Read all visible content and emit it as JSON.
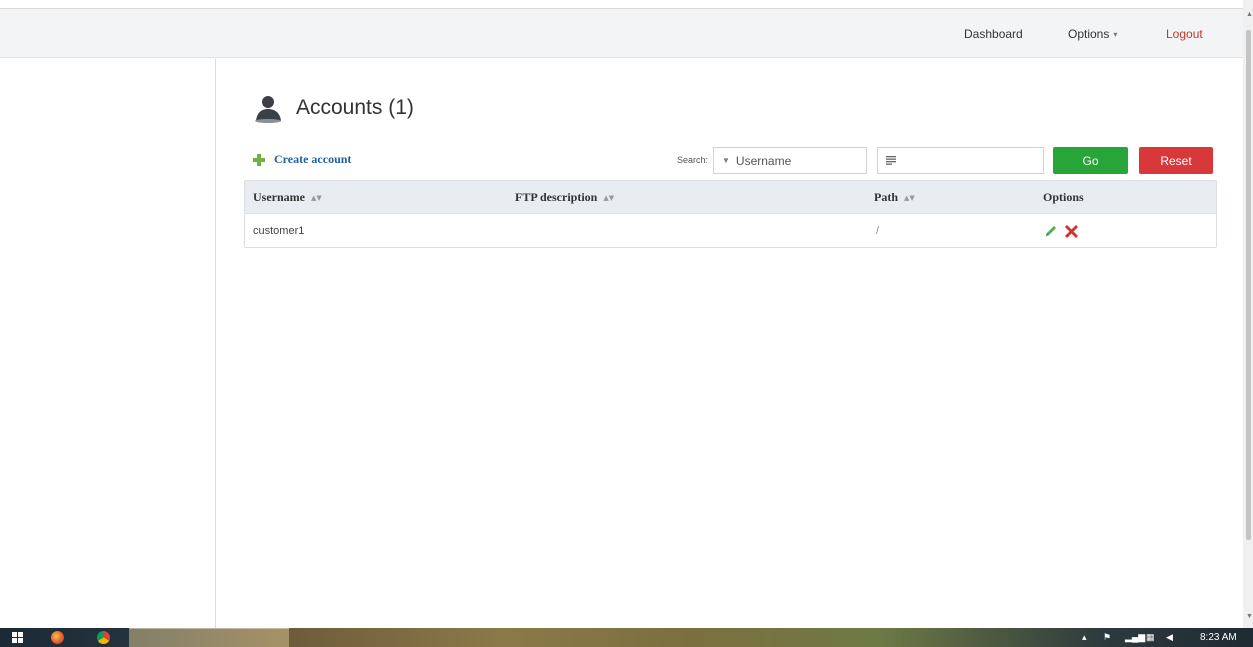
{
  "nav": {
    "dashboard": "Dashboard",
    "options": "Options",
    "logout": "Logout"
  },
  "page": {
    "title": "Accounts (1)"
  },
  "toolbar": {
    "create_account": "Create account",
    "search_label": "Search:",
    "search_field_selected": "Username",
    "search_value": "",
    "go": "Go",
    "reset": "Reset"
  },
  "table": {
    "columns": {
      "username": "Username",
      "ftp_description": "FTP description",
      "path": "Path",
      "options": "Options"
    },
    "rows": [
      {
        "username": "customer1",
        "ftp_description": "",
        "path": "/"
      }
    ]
  },
  "taskbar": {
    "time": "8:23 AM"
  },
  "colors": {
    "go": "#27a539",
    "reset": "#d8383a",
    "logout": "#c0392b",
    "link": "#1f5fa5"
  }
}
